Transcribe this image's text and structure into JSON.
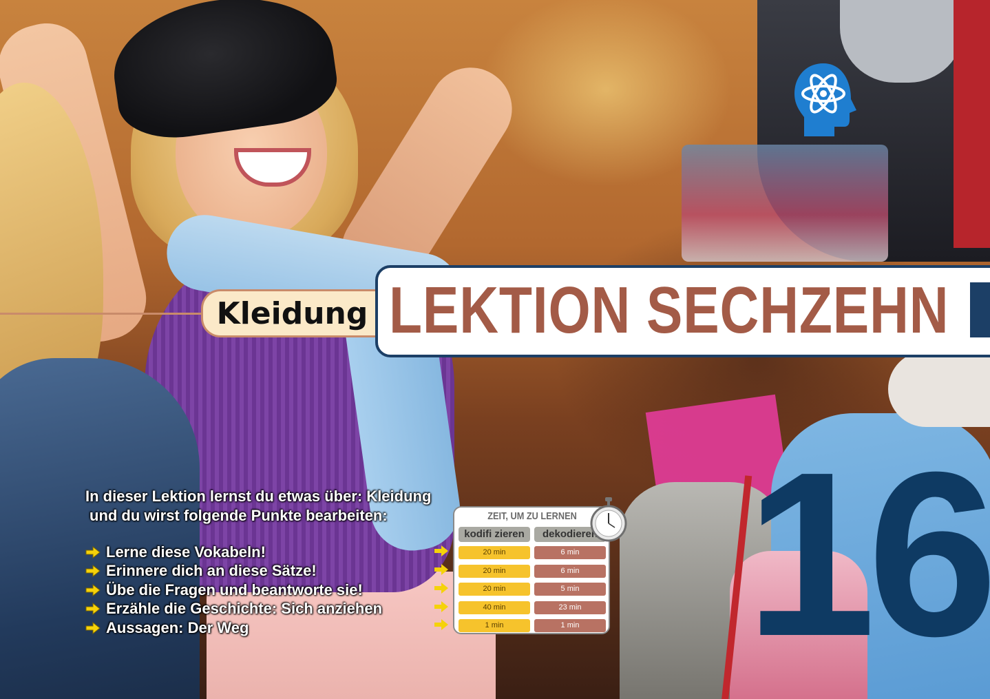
{
  "lesson": {
    "topic": "Kleidung",
    "title": "LEKTION SECHZEHN",
    "number": "16"
  },
  "intro": {
    "line1": "In dieser Lektion lernst du etwas über: Kleidung",
    "line2": "und du wirst folgende Punkte bearbeiten:"
  },
  "points": [
    "Lerne diese Vokabeln!",
    "Erinnere dich an diese Sätze!",
    "Übe die Fragen und beantworte sie!",
    "Erzähle die Geschichte: Sich anziehen",
    "Aussagen: Der Weg"
  ],
  "time_table": {
    "title": "ZEIT, UM ZU LERNEN",
    "headers": [
      "kodifi zieren",
      "dekodieren"
    ],
    "rows": [
      [
        "20 min",
        "6 min"
      ],
      [
        "20 min",
        "6 min"
      ],
      [
        "20 min",
        "5 min"
      ],
      [
        "40 min",
        "23 min"
      ],
      [
        "1 min",
        "1 min"
      ]
    ]
  },
  "icons": {
    "head": "brain-atom-head-icon",
    "arrow": "yellow-arrow-icon",
    "stopwatch": "stopwatch-icon"
  },
  "colors": {
    "title": "#a35b47",
    "navy": "#0e3a63",
    "arrow": "#f5d20a",
    "pill": "#fbe9c8",
    "code": "#f6c32c",
    "decode": "#b87263"
  }
}
